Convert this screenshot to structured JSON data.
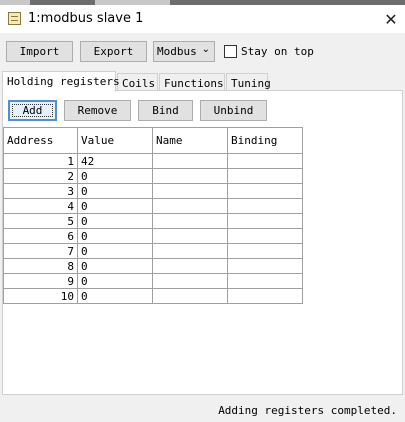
{
  "window": {
    "title": "1:modbus slave 1",
    "close_glyph": "✕"
  },
  "toolbar": {
    "import_label": "Import",
    "export_label": "Export",
    "protocol_value": "Modbus",
    "stay_on_top_label": "Stay on top",
    "stay_on_top_checked": false
  },
  "tabs": [
    {
      "label": "Holding registers",
      "active": true
    },
    {
      "label": "Coils",
      "active": false
    },
    {
      "label": "Functions",
      "active": false
    },
    {
      "label": "Tuning",
      "active": false
    }
  ],
  "actions": {
    "add_label": "Add",
    "remove_label": "Remove",
    "bind_label": "Bind",
    "unbind_label": "Unbind"
  },
  "table": {
    "columns": [
      "Address",
      "Value",
      "Name",
      "Binding"
    ],
    "rows": [
      {
        "address": "1",
        "value": "42",
        "name": "",
        "binding": ""
      },
      {
        "address": "2",
        "value": "0",
        "name": "",
        "binding": ""
      },
      {
        "address": "3",
        "value": "0",
        "name": "",
        "binding": ""
      },
      {
        "address": "4",
        "value": "0",
        "name": "",
        "binding": ""
      },
      {
        "address": "5",
        "value": "0",
        "name": "",
        "binding": ""
      },
      {
        "address": "6",
        "value": "0",
        "name": "",
        "binding": ""
      },
      {
        "address": "7",
        "value": "0",
        "name": "",
        "binding": ""
      },
      {
        "address": "8",
        "value": "0",
        "name": "",
        "binding": ""
      },
      {
        "address": "9",
        "value": "0",
        "name": "",
        "binding": ""
      },
      {
        "address": "10",
        "value": "0",
        "name": "",
        "binding": ""
      }
    ]
  },
  "status": {
    "message": "Adding registers completed."
  },
  "colors": {
    "window_bg": "#f0f0f0",
    "focus_accent": "#4f8fd6"
  }
}
